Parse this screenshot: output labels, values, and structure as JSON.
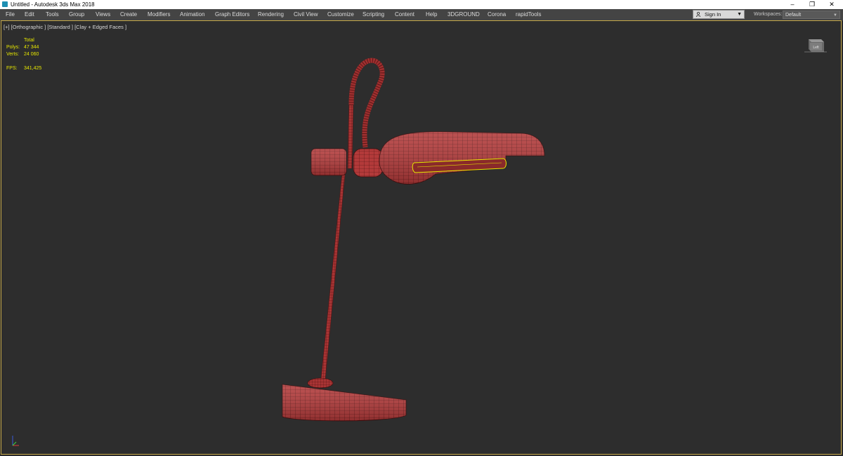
{
  "titlebar": {
    "title": "Untitled - Autodesk 3ds Max 2018",
    "minimize": "–",
    "maximize": "❐",
    "close": "✕"
  },
  "menubar": {
    "items": [
      "File",
      "Edit",
      "Tools",
      "Group",
      "Views",
      "Create",
      "Modifiers",
      "Animation",
      "Graph Editors",
      "Rendering",
      "Civil View",
      "Customize",
      "Scripting",
      "Content",
      "Help",
      "3DGROUND",
      "Corona",
      "rapidTools"
    ],
    "signin": "Sign In",
    "workspaces_label": "Workspaces:",
    "workspaces_value": "Default"
  },
  "viewport": {
    "label": "[+] [Orthographic ] [Standard ] [Clay + Edged Faces ]",
    "stats": {
      "header": "Total",
      "polys_label": "Polys:",
      "polys_value": "47 344",
      "verts_label": "Verts:",
      "verts_value": "24 060",
      "fps_label": "FPS:",
      "fps_value": "341,425"
    },
    "viewcube_label": "Left"
  },
  "colors": {
    "viewport_bg": "#2d2d2d",
    "lamp_fill": "#b33a3a",
    "wire": "#4a1010",
    "selection": "#e6e600",
    "stats_text": "#e6e600"
  }
}
